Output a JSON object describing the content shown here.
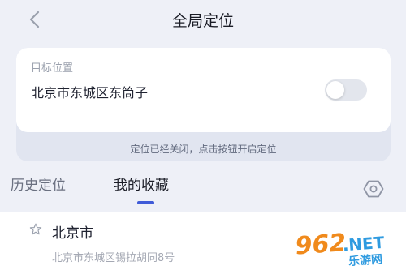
{
  "header": {
    "title": "全局定位"
  },
  "target_card": {
    "label": "目标位置",
    "address": "北京市东城区东筒子",
    "location_toggle_on": false,
    "status_text": "定位已经关闭，点击按钮开启定位"
  },
  "tabs": [
    {
      "label": "历史定位",
      "active": false
    },
    {
      "label": "我的收藏",
      "active": true
    }
  ],
  "favorites": [
    {
      "name": "北京市",
      "address": "北京市东城区锡拉胡同8号",
      "icon": "star-icon"
    }
  ],
  "colors": {
    "background": "#eef0f7",
    "accent": "#3f5bd8",
    "card": "#ffffff",
    "status_bar": "#e1e5f0"
  },
  "watermark": {
    "text": "962.NET",
    "subtext": "乐游网"
  }
}
